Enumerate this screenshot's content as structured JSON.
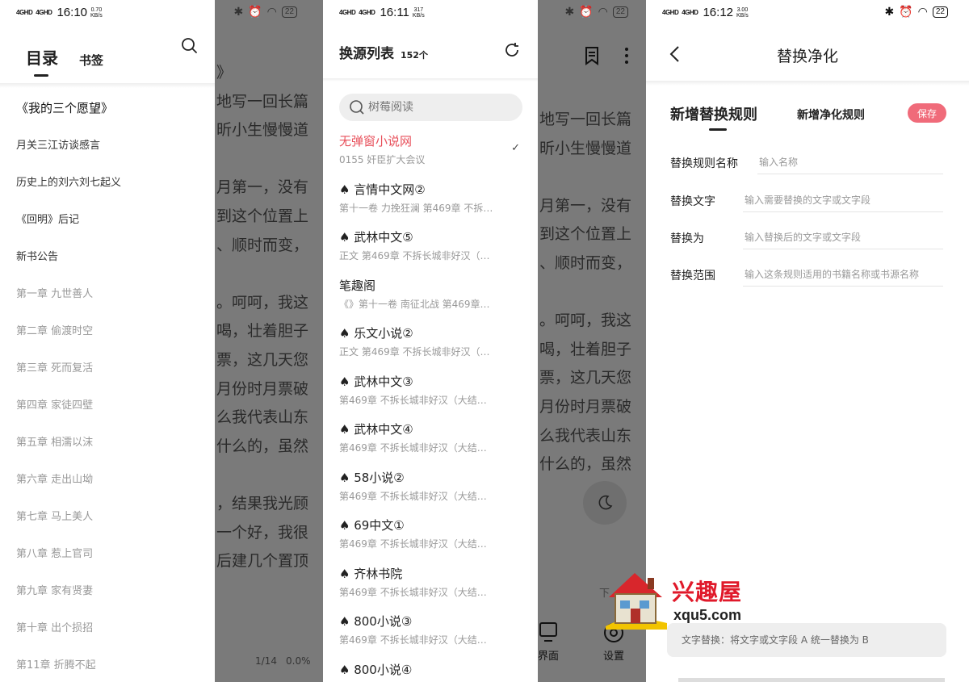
{
  "screen1": {
    "status": {
      "signal_a": "4GHD",
      "signal_b": "4GHD",
      "time": "16:10",
      "speed": "0.70\nKB/s",
      "battery": "22"
    },
    "tabs": {
      "toc": "目录",
      "bookmarks": "书签"
    },
    "toc_items": [
      "《我的三个愿望》",
      "月关三江访谈感言",
      "历史上的刘六刘七起义",
      "《回明》后记",
      "新书公告",
      "第一章 九世善人",
      "第二章 偷渡时空",
      "第三章 死而复活",
      "第四章 家徒四壁",
      "第五章 相濡以沫",
      "第六章 走出山坳",
      "第七章 马上美人",
      "第八章 惹上官司",
      "第九章 家有贤妻",
      "第十章 出个损招",
      "第11章 折腾不起"
    ],
    "reader_lines": [
      "》",
      "地写一回长篇",
      "昕小生慢慢道",
      "",
      "月第一，没有",
      "到这个位置上",
      "、顺时而变，",
      "",
      "。呵呵，我这",
      "喝，壮着胆子",
      "票，这几天您",
      "月份时月票破",
      "么我代表山东",
      "什么的，虽然",
      "",
      "，结果我光顾",
      "一个好，我很",
      "后建几个置顶"
    ],
    "page_info": "1/14",
    "progress": "0.0%"
  },
  "screen2": {
    "status": {
      "signal_a": "4GHD",
      "signal_b": "4GHD",
      "time": "16:11",
      "speed": "317\nKB/s",
      "battery": "22"
    },
    "title": "换源列表",
    "count": "152个",
    "search_placeholder": "树莓阅读",
    "sources": [
      {
        "name": "无弹窗小说网",
        "sub": "0155 奸臣扩大会议",
        "active": true
      },
      {
        "name": "♠ 言情中文网②",
        "sub": "第十一卷 力挽狂澜 第469章 不拆…"
      },
      {
        "name": "♠ 武林中文⑤",
        "sub": "正文 第469章 不拆长城非好汉（…"
      },
      {
        "name": "笔趣阁",
        "sub": "《》第十一卷 南征北战 第469章…"
      },
      {
        "name": "♠ 乐文小说②",
        "sub": "正文 第469章 不拆长城非好汉（…"
      },
      {
        "name": "♠ 武林中文③",
        "sub": "第469章 不拆长城非好汉（大结…"
      },
      {
        "name": "♠ 武林中文④",
        "sub": "第469章 不拆长城非好汉（大结…"
      },
      {
        "name": "♠ 58小说②",
        "sub": "第469章 不拆长城非好汉（大结…"
      },
      {
        "name": "♠ 69中文①",
        "sub": "第469章 不拆长城非好汉（大结…"
      },
      {
        "name": "♠ 齐林书院",
        "sub": "第469章 不拆长城非好汉（大结…"
      },
      {
        "name": "♠ 800小说③",
        "sub": "第469章 不拆长城非好汉（大结…"
      },
      {
        "name": "♠ 800小说④",
        "sub": ""
      }
    ],
    "reader_lines": [
      "地写一回长篇",
      "昕小生慢慢道",
      "",
      "月第一，没有",
      "到这个位置上",
      "、顺时而变，",
      "",
      "。呵呵，我这",
      "喝，壮着胆子",
      "票，这几天您",
      "月份时月票破",
      "么我代表山东",
      "什么的，虽然"
    ],
    "bottom_tabs": {
      "ui": "界面",
      "settings": "设置",
      "next": "下"
    }
  },
  "screen3": {
    "status": {
      "signal_a": "4GHD",
      "signal_b": "4GHD",
      "time": "16:12",
      "speed": "3.00\nKB/s",
      "battery": "22"
    },
    "title": "替换净化",
    "tab_replace": "新增替换规则",
    "tab_purify": "新增净化规则",
    "save": "保存",
    "fields": [
      {
        "label": "替换规则名称",
        "placeholder": "输入名称"
      },
      {
        "label": "替换文字",
        "placeholder": "输入需要替换的文字或文字段"
      },
      {
        "label": "替换为",
        "placeholder": "输入替换后的文字或文字段"
      },
      {
        "label": "替换范围",
        "placeholder": "输入这条规则适用的书籍名称或书源名称"
      }
    ],
    "hint": "文字替换：将文字或文字段 A 统一替换为 B"
  },
  "watermark": {
    "name": "兴趣屋",
    "url": "xqu5.com"
  },
  "colors": {
    "accent": "#e8505b",
    "save_button": "#f06b7a",
    "dim_overlay": "#7a7a7a"
  }
}
